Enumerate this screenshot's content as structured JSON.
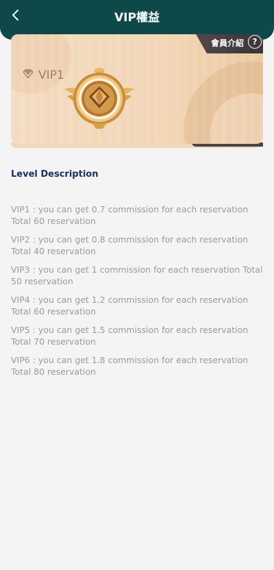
{
  "header": {
    "title": "VIP權益",
    "back_icon": "chevron-left-icon"
  },
  "card": {
    "member_label": "會員介紹",
    "help_symbol": "?",
    "vip_level": "VIP1",
    "badge_icon": "diamond-icon",
    "medal_icon": "vip-medal-icon",
    "colors": {
      "card": "#f2d6b6",
      "tag": "#3a3536",
      "header": "#0e4848"
    }
  },
  "section": {
    "title": "Level Description",
    "items": [
      "VIP1 : you can get 0.7 commission for each reservation Total 60 reservation",
      "VIP2 : you can get 0.8 commission for each reservation Total 40 reservation",
      "VIP3 : you can get 1 commission for each reservation Total 50 reservation",
      "VIP4 : you can get 1.2 commission for each reservation Total 60 reservation",
      "VIP5 : you can get 1.5 commission for each reservation Total 70 reservation",
      "VIP6 : you can get 1.8 commission for each reservation Total 80 reservation"
    ]
  }
}
